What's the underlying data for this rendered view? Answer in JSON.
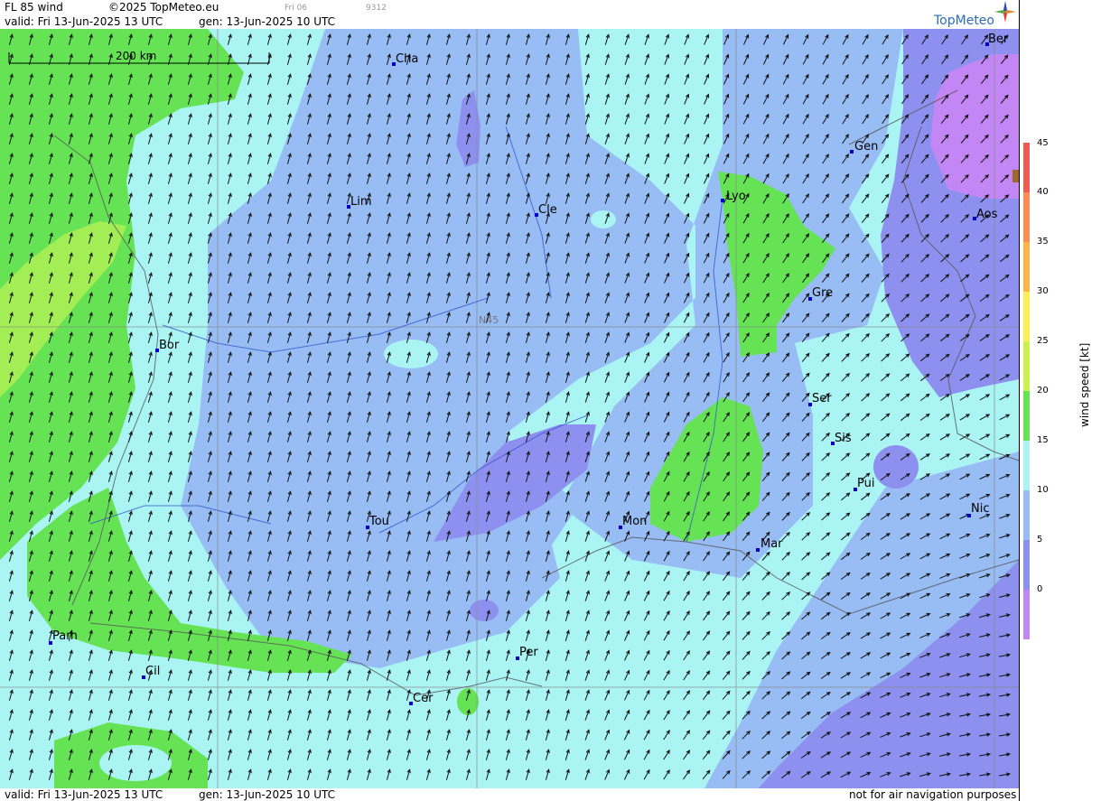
{
  "header": {
    "product": "FL 85 wind",
    "copyright": "©2025 TopMeteo.eu",
    "run_tag": "Fri 06",
    "code": "9312",
    "valid": "valid:  Fri  13-Jun-2025  13 UTC",
    "gen": "gen: 13-Jun-2025 10 UTC"
  },
  "footer": {
    "valid": "valid:  Fri  13-Jun-2025  13 UTC",
    "gen": "gen: 13-Jun-2025 10 UTC",
    "disclaimer": "not for air navigation purposes"
  },
  "logo": {
    "text": "TopMeteo"
  },
  "scale_bar": {
    "label": "200 km"
  },
  "grid": {
    "label": "N45"
  },
  "cities": [
    {
      "name": "Cha"
    },
    {
      "name": "Ber"
    },
    {
      "name": "Gen"
    },
    {
      "name": "Lim"
    },
    {
      "name": "Cle"
    },
    {
      "name": "Lyo"
    },
    {
      "name": "Aos"
    },
    {
      "name": "Gre"
    },
    {
      "name": "Bor"
    },
    {
      "name": "Ser"
    },
    {
      "name": "Sis"
    },
    {
      "name": "Pui"
    },
    {
      "name": "Tou"
    },
    {
      "name": "Mon"
    },
    {
      "name": "Nic"
    },
    {
      "name": "Mar"
    },
    {
      "name": "Pam"
    },
    {
      "name": "Per"
    },
    {
      "name": "Cil"
    },
    {
      "name": "Cer"
    }
  ],
  "legend": {
    "title": "wind speed [kt]",
    "ticks": [
      "45",
      "40",
      "35",
      "30",
      "25",
      "20",
      "15",
      "10",
      "5",
      "0"
    ],
    "colors": [
      "#f05a50",
      "#ff8c55",
      "#ffb44a",
      "#ffee55",
      "#ccf050",
      "#66e355",
      "#aaf4f4",
      "#98bcf4",
      "#8e90f0",
      "#c387f5"
    ]
  },
  "colors": {
    "green": "#66e355",
    "lightgreen": "#a4ee55",
    "cyan": "#aaf4f4",
    "lightblue": "#98bcf4",
    "blue": "#8e90f0",
    "violet": "#c387f5"
  }
}
